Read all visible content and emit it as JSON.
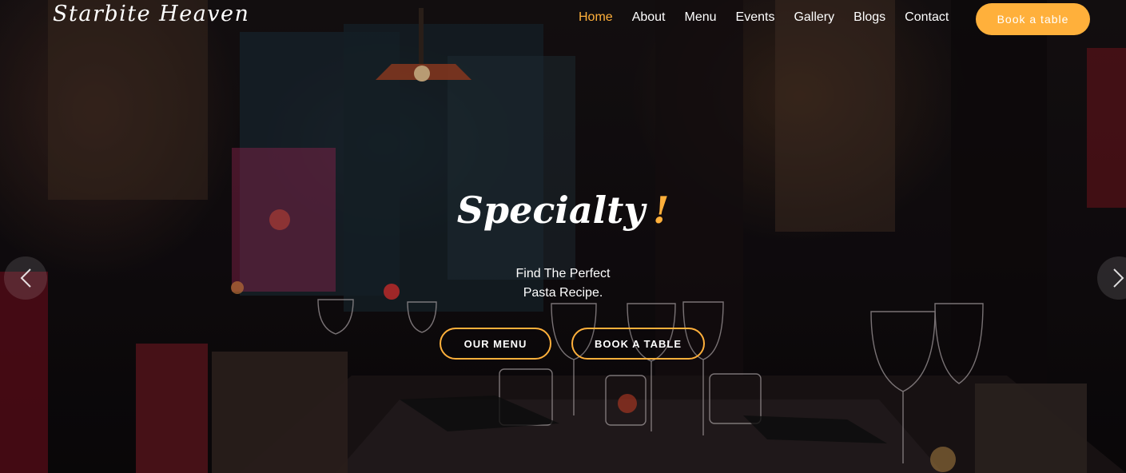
{
  "brand": {
    "name": "Starbite Heaven"
  },
  "nav": {
    "items": [
      {
        "label": "Home",
        "active": true
      },
      {
        "label": "About"
      },
      {
        "label": "Menu"
      },
      {
        "label": "Events"
      },
      {
        "label": "Gallery"
      },
      {
        "label": "Blogs"
      },
      {
        "label": "Contact"
      }
    ],
    "cta_label": "Book a table"
  },
  "hero": {
    "headline": "Specialty",
    "headline_mark": "!",
    "subtitle_line1": "Find The Perfect",
    "subtitle_line2": "Pasta Recipe.",
    "primary_button": "OUR MENU",
    "secondary_button": "BOOK A TABLE",
    "prev_icon": "chevron-left-icon",
    "next_icon": "chevron-right-icon"
  },
  "colors": {
    "accent": "#ffb03b",
    "text": "#ffffff"
  }
}
